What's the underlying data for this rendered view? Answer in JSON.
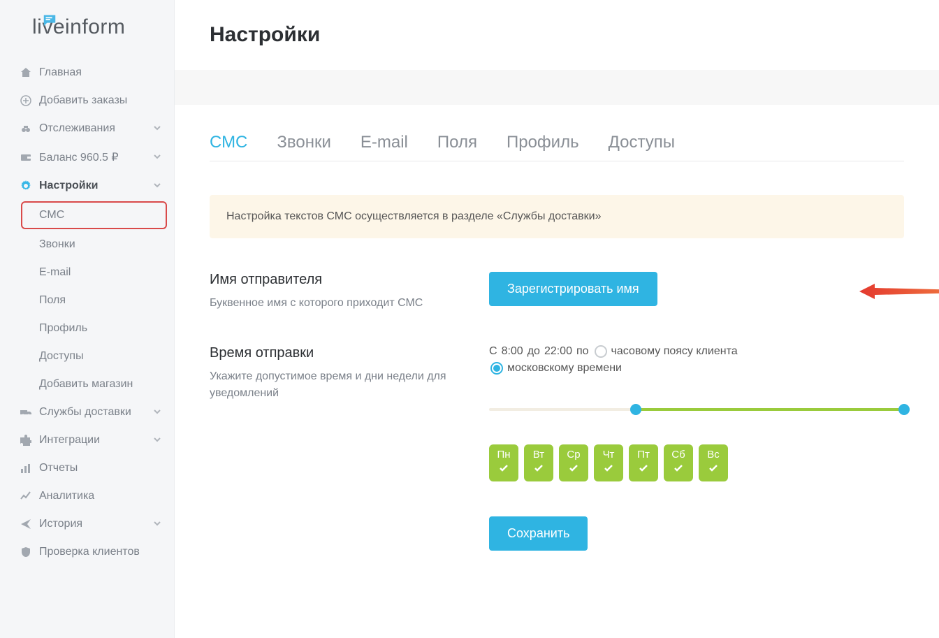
{
  "brand": {
    "live": "live",
    "inform": "inform"
  },
  "sidebar": {
    "items": [
      {
        "label": "Главная"
      },
      {
        "label": "Добавить заказы"
      },
      {
        "label": "Отслеживания"
      },
      {
        "label": "Баланс 960.5 ₽"
      },
      {
        "label": "Настройки"
      }
    ],
    "sub": [
      {
        "label": "СМС"
      },
      {
        "label": "Звонки"
      },
      {
        "label": "E-mail"
      },
      {
        "label": "Поля"
      },
      {
        "label": "Профиль"
      },
      {
        "label": "Доступы"
      },
      {
        "label": "Добавить магазин"
      }
    ],
    "tail": [
      {
        "label": "Службы доставки"
      },
      {
        "label": "Интеграции"
      },
      {
        "label": "Отчеты"
      },
      {
        "label": "Аналитика"
      },
      {
        "label": "История"
      },
      {
        "label": "Проверка клиентов"
      }
    ]
  },
  "page": {
    "title": "Настройки"
  },
  "tabs": [
    {
      "label": "СМС"
    },
    {
      "label": "Звонки"
    },
    {
      "label": "E-mail"
    },
    {
      "label": "Поля"
    },
    {
      "label": "Профиль"
    },
    {
      "label": "Доступы"
    }
  ],
  "notice": "Настройка текстов СМС осуществляется в разделе «Службы доставки»",
  "sender": {
    "title": "Имя отправителя",
    "desc": "Буквенное имя с которого приходит СМС",
    "button": "Зарегистрировать имя"
  },
  "time": {
    "title": "Время отправки",
    "desc": "Укажите допустимое время и дни недели для уведомлений",
    "prefix": "С",
    "start": "8:00",
    "sep": "до",
    "end": "22:00",
    "by": "по",
    "radio_client": "часовому поясу клиента",
    "radio_moscow": "московскому времени"
  },
  "days": [
    "Пн",
    "Вт",
    "Ср",
    "Чт",
    "Пт",
    "Сб",
    "Вс"
  ],
  "save": "Сохранить"
}
